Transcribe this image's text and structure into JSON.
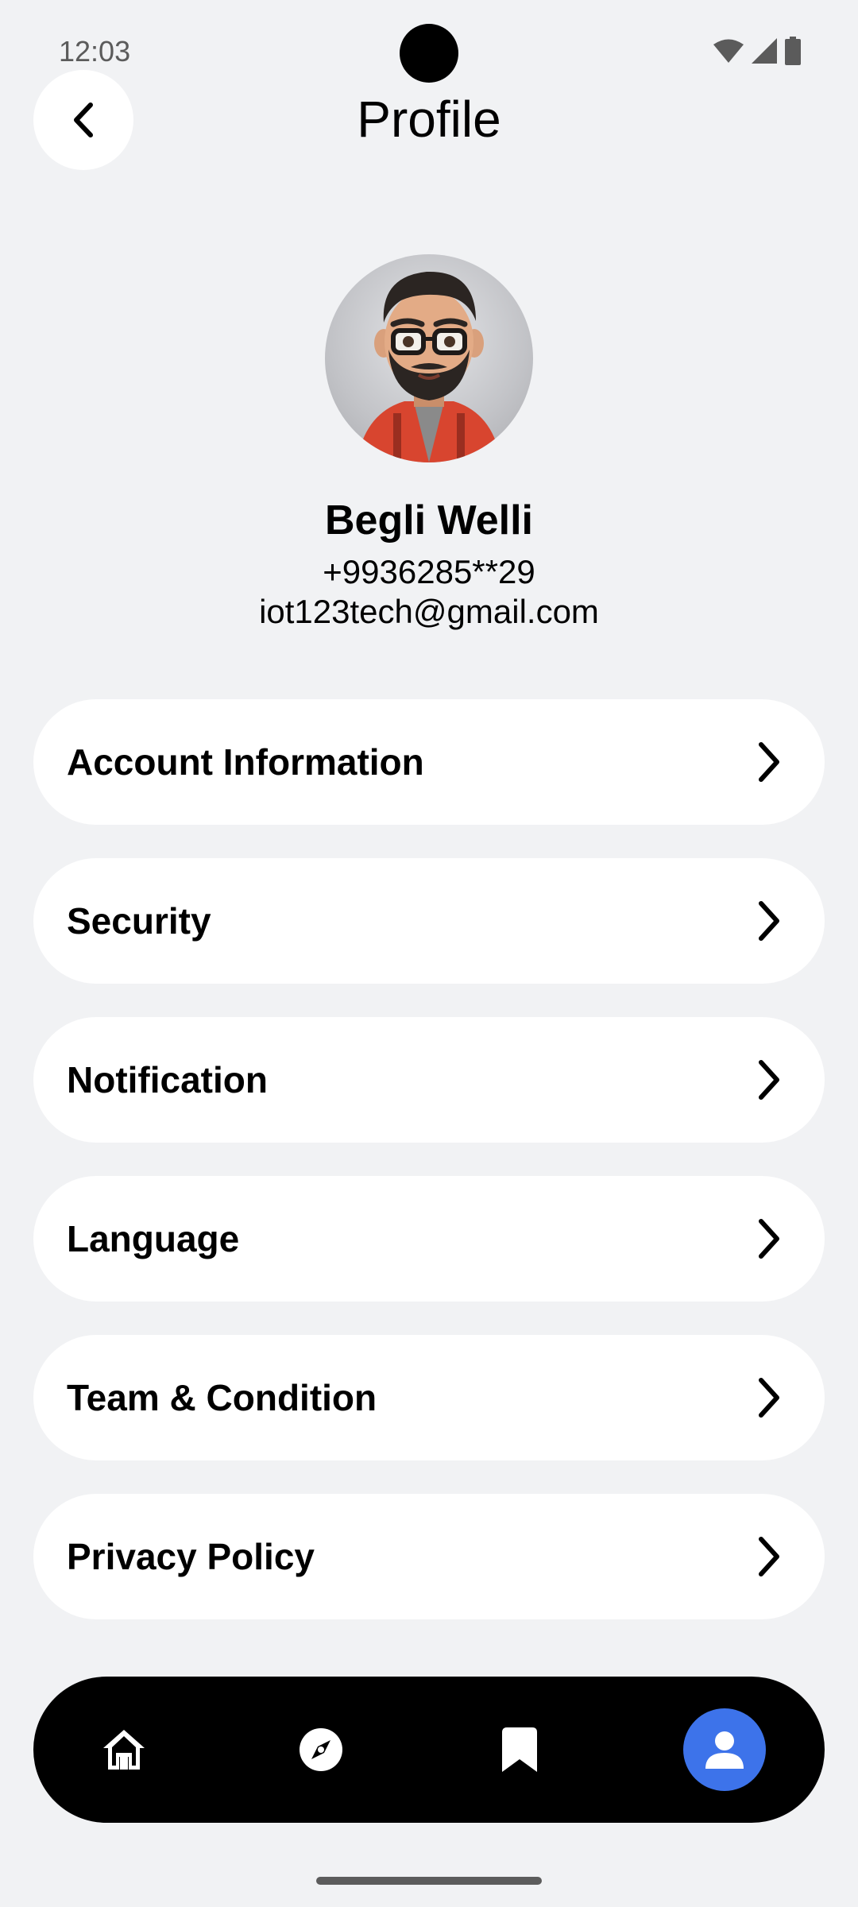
{
  "status_bar": {
    "time": "12:03"
  },
  "header": {
    "title": "Profile",
    "back_icon": "chevron-left-icon"
  },
  "profile": {
    "name": "Begli Welli",
    "phone": "+9936285**29",
    "email": "iot123tech@gmail.com"
  },
  "menu": {
    "items": [
      {
        "label": "Account Information",
        "icon": "chevron-right-icon"
      },
      {
        "label": "Security",
        "icon": "chevron-right-icon"
      },
      {
        "label": "Notification",
        "icon": "chevron-right-icon"
      },
      {
        "label": "Language",
        "icon": "chevron-right-icon"
      },
      {
        "label": "Team & Condition",
        "icon": "chevron-right-icon"
      },
      {
        "label": "Privacy Policy",
        "icon": "chevron-right-icon"
      }
    ]
  },
  "bottom_nav": {
    "items": [
      {
        "icon": "home-icon",
        "active": false
      },
      {
        "icon": "compass-icon",
        "active": false
      },
      {
        "icon": "bookmark-icon",
        "active": false
      },
      {
        "icon": "user-icon",
        "active": true
      }
    ],
    "active_color": "#3d73ea"
  },
  "colors": {
    "background": "#f1f2f4",
    "card": "#ffffff",
    "nav_bar": "#000000",
    "accent": "#3d73ea"
  }
}
